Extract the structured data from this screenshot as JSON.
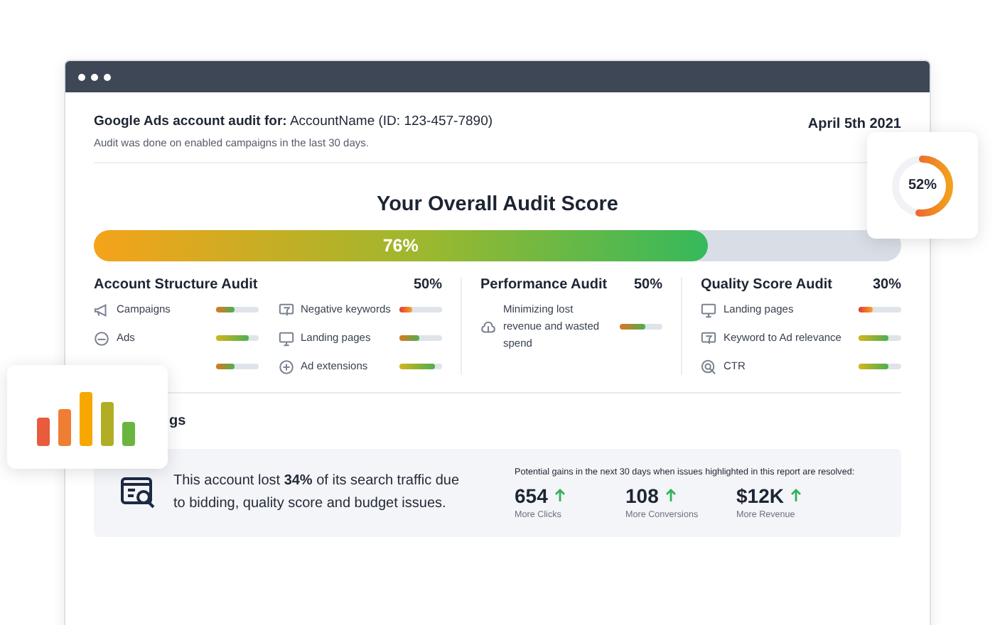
{
  "header": {
    "title": "**Google Ads account audit for:** AccountName (ID: 123-457-7890)",
    "subtitle": "Audit was done on enabled campaigns in the last 30 days.",
    "date": "April 5th 2021"
  },
  "overall": {
    "title": "Your Overall Audit Score",
    "level": 0.76,
    "reading": "76%"
  },
  "sections": [
    {
      "title": "Account Structure Audit",
      "score": "50%",
      "items": [
        {
          "kind": "megaphone",
          "label": "Campaigns",
          "level": 0.45
        },
        {
          "kind": "badge",
          "label": "Ads",
          "level": 0.78
        },
        {
          "level": 0.45
        },
        {
          "kind": "filter",
          "label": "Negative keywords",
          "level": 0.3
        },
        {
          "kind": "monitor",
          "label": "Landing pages",
          "level": 0.45
        },
        {
          "kind": "plus",
          "label": "Ad extensions",
          "level": 0.82
        }
      ]
    },
    {
      "title": "Performance Audit",
      "score": "50%",
      "items": [
        {
          "kind": "cloud",
          "label": "Minimizing lost revenue and wasted spend",
          "level": 0.6
        }
      ]
    },
    {
      "title": "Quality Score Audit",
      "score": "30%",
      "items": [
        {
          "kind": "monitor",
          "label": "Landing pages",
          "level": 0.33
        },
        {
          "kind": "filter",
          "label": "Keyword to Ad relevance",
          "level": 0.7
        },
        {
          "kind": "target",
          "label": "CTR",
          "level": 0.7
        }
      ]
    }
  ],
  "findings": {
    "heading": "gs",
    "summary": "This account lost **34%** of its search traffic due to bidding, quality score and budget issues.",
    "gains_caption": "Potential gains in the next 30 days when issues highlighted in this report are resolved:",
    "stats": [
      {
        "value": "654",
        "label": "More Clicks"
      },
      {
        "value": "108",
        "label": "More Conversions"
      },
      {
        "value": "$12K",
        "label": "More Revenue"
      }
    ]
  },
  "donut_card": {
    "reading": "52%"
  }
}
